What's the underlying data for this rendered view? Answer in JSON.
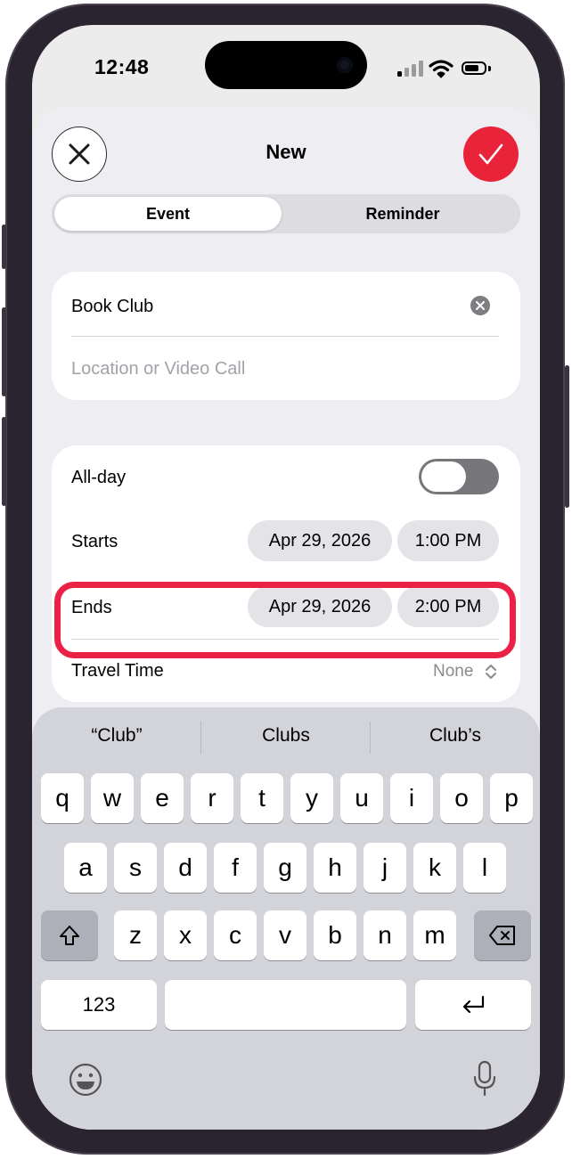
{
  "status_bar": {
    "time": "12:48"
  },
  "header": {
    "title": "New"
  },
  "tabs": [
    {
      "label": "Event",
      "selected": true
    },
    {
      "label": "Reminder",
      "selected": false
    }
  ],
  "event": {
    "title_value": "Book Club",
    "location_placeholder": "Location or Video Call"
  },
  "schedule": {
    "all_day_label": "All-day",
    "all_day_on": false,
    "starts_label": "Starts",
    "starts_date": "Apr 29, 2026",
    "starts_time": "1:00 PM",
    "ends_label": "Ends",
    "ends_date": "Apr 29, 2026",
    "ends_time": "2:00 PM",
    "travel_label": "Travel Time",
    "travel_value": "None"
  },
  "keyboard": {
    "suggestions": [
      "“Club”",
      "Clubs",
      "Club’s"
    ],
    "row1": [
      "q",
      "w",
      "e",
      "r",
      "t",
      "y",
      "u",
      "i",
      "o",
      "p"
    ],
    "row2": [
      "a",
      "s",
      "d",
      "f",
      "g",
      "h",
      "j",
      "k",
      "l"
    ],
    "row3": [
      "z",
      "x",
      "c",
      "v",
      "b",
      "n",
      "m"
    ],
    "numbers_label": "123"
  },
  "colors": {
    "accent_red": "#e8233a",
    "highlight": "#ea2346",
    "toggle_off": "#77767b"
  }
}
